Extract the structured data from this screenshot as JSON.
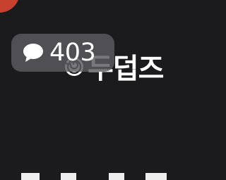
{
  "app": {
    "comment_count": "403",
    "comment_icon": "speech-bubble-icon",
    "title_partial": "두덥즈",
    "title_emoji": "swirl-emoji-icon"
  },
  "colors": {
    "background": "#1b1b1d",
    "avatar": "#c8412f",
    "badge": "#5c5c60",
    "text": "#ffffff"
  }
}
